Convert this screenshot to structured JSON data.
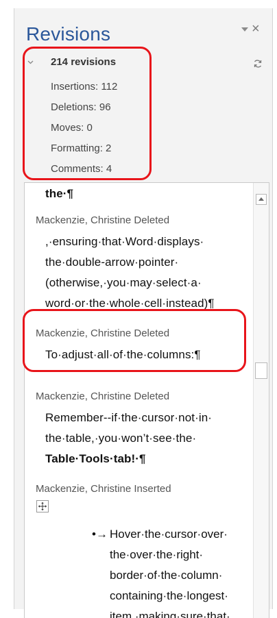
{
  "pane": {
    "title": "Revisions",
    "close_glyph": "×",
    "menu_icon": "dropdown-triangle-icon",
    "refresh_icon": "refresh-icon"
  },
  "summary": {
    "total": "214 revisions",
    "insertions": "Insertions: 112",
    "deletions": "Deletions: 96",
    "moves": "Moves: 0",
    "formatting": "Formatting: 2",
    "comments": "Comments: 4"
  },
  "revisions": {
    "r0": {
      "text": "the·¶"
    },
    "r1": {
      "author": "Mackenzie, Christine Deleted",
      "line1": ",·ensuring·that·Word·displays·",
      "line2": "the·double-arrow·pointer·",
      "line3": "(otherwise,·you·may·select·a·",
      "line4": "word·or·the·whole·cell·instead)¶"
    },
    "r2": {
      "author": "Mackenzie, Christine Deleted",
      "line1": "To·adjust·all·of·the·columns:¶"
    },
    "r3": {
      "author": "Mackenzie, Christine Deleted",
      "line1": "Remember--if·the·cursor·not·in·",
      "line2": "the·table,·you·won’t·see·the·",
      "line3": "Table·Tools·tab!·¶"
    },
    "r4": {
      "author": "Mackenzie, Christine Inserted",
      "bullet": "•→",
      "line1": "Hover·the·cursor·over·",
      "line2": "the·over·the·right·",
      "line3": "border·of·the·column·",
      "line4": "containing·the·longest·",
      "line5": "item,·making·sure·that·"
    }
  },
  "colors": {
    "title_blue": "#2b579a",
    "highlight_red": "#e8141a"
  }
}
